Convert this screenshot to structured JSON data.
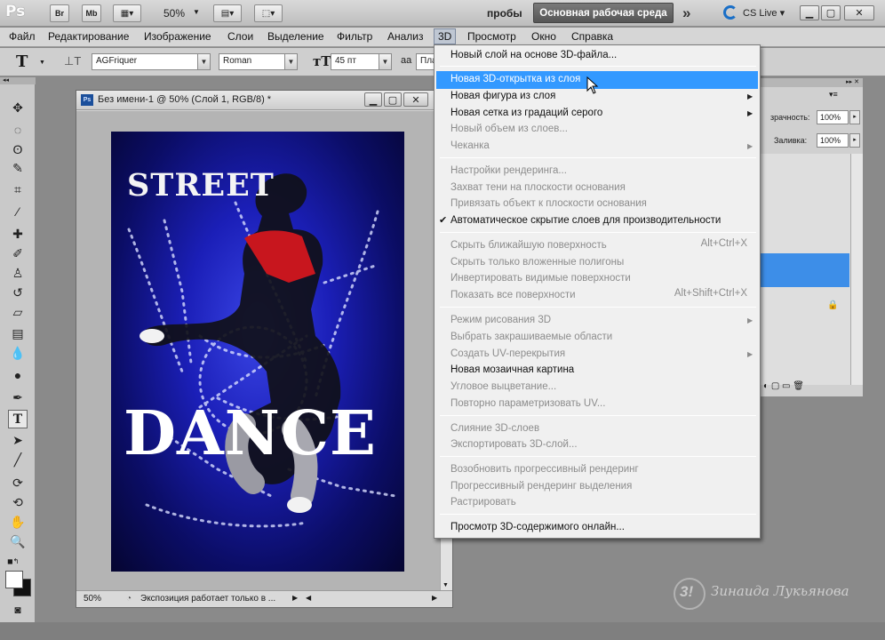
{
  "appbar": {
    "logo": "Ps",
    "br_label": "Br",
    "mb_label": "Mb",
    "zoom": "50%",
    "workspace_probe": "пробы",
    "workspace_main": "Основная рабочая среда",
    "more": "»",
    "cslive": "CS Live"
  },
  "menubar": {
    "items": [
      "Файл",
      "Редактирование",
      "Изображение",
      "Слои",
      "Выделение",
      "Фильтр",
      "Анализ",
      "3D",
      "Просмотр",
      "Окно",
      "Справка"
    ]
  },
  "options": {
    "font_family": "AGFriquer",
    "font_style": "Roman",
    "font_size": "45 пт",
    "aa_value": "Пла",
    "aa_icon": "aa"
  },
  "document": {
    "title": "Без имени-1 @ 50% (Слой 1, RGB/8) *",
    "zoom": "50%",
    "status": "Экспозиция работает только в ..."
  },
  "poster": {
    "street": "STREET",
    "dance": "DANCE"
  },
  "rightpanel": {
    "opacity_label": "зрачность:",
    "opacity_value": "100%",
    "fill_label": "Заливка:",
    "fill_value": "100%"
  },
  "menu3d": {
    "items": [
      {
        "label": "Новый слой на основе 3D-файла...",
        "disabled": false
      },
      {
        "label": "Новая 3D-открытка из слоя",
        "disabled": false,
        "highlighted": true
      },
      {
        "label": "Новая фигура из слоя",
        "disabled": false,
        "submenu": true
      },
      {
        "label": "Новая сетка из градаций серого",
        "disabled": false,
        "submenu": true
      },
      {
        "label": "Новый объем из слоев...",
        "disabled": true
      },
      {
        "label": "Чеканка",
        "disabled": true,
        "submenu": true
      },
      {
        "label": "Настройки рендеринга...",
        "disabled": true
      },
      {
        "label": "Захват тени на плоскости основания",
        "disabled": true
      },
      {
        "label": "Привязать объект к плоскости основания",
        "disabled": true
      },
      {
        "label": "Автоматическое скрытие слоев для производительности",
        "disabled": false,
        "checked": true
      },
      {
        "label": "Скрыть ближайшую поверхность",
        "disabled": true,
        "shortcut": "Alt+Ctrl+X"
      },
      {
        "label": "Скрыть только вложенные полигоны",
        "disabled": true
      },
      {
        "label": "Инвертировать видимые поверхности",
        "disabled": true
      },
      {
        "label": "Показать все поверхности",
        "disabled": true,
        "shortcut": "Alt+Shift+Ctrl+X"
      },
      {
        "label": "Режим рисования 3D",
        "disabled": true,
        "submenu": true
      },
      {
        "label": "Выбрать закрашиваемые области",
        "disabled": true
      },
      {
        "label": "Создать UV-перекрытия",
        "disabled": true,
        "submenu": true
      },
      {
        "label": "Новая мозаичная картина",
        "disabled": false
      },
      {
        "label": "Угловое выцветание...",
        "disabled": true
      },
      {
        "label": "Повторно параметризовать UV...",
        "disabled": true
      },
      {
        "label": "Слияние 3D-слоев",
        "disabled": true
      },
      {
        "label": "Экспортировать 3D-слой...",
        "disabled": true
      },
      {
        "label": "Возобновить прогрессивный рендеринг",
        "disabled": true
      },
      {
        "label": "Прогрессивный рендеринг выделения",
        "disabled": true
      },
      {
        "label": "Растрировать",
        "disabled": true
      },
      {
        "label": "Просмотр 3D-содержимого онлайн...",
        "disabled": false
      }
    ]
  },
  "watermark": {
    "badge": "3!",
    "signature": "Зинаида Лукьянова"
  },
  "colors": {
    "menu_highlight": "#3399ff",
    "layer_highlight": "#3d8ee8",
    "poster_blue": "#1b1fb8"
  }
}
